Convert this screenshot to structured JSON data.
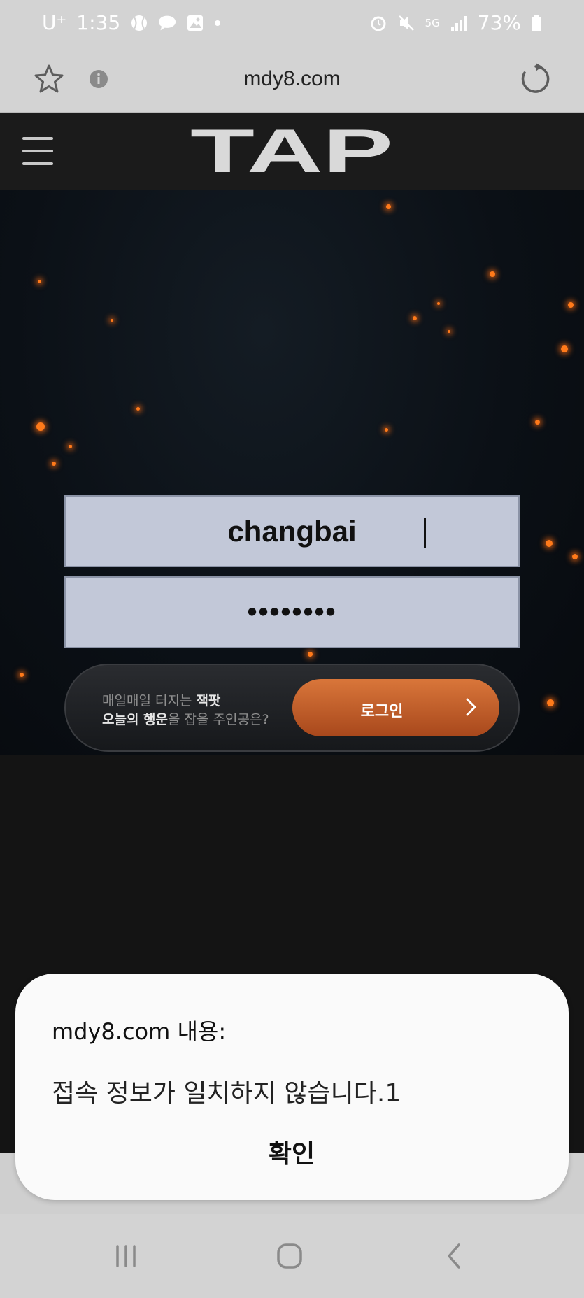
{
  "status_bar": {
    "carrier": "U⁺",
    "time": "1:35",
    "battery": "73%",
    "network": "5G"
  },
  "browser": {
    "url": "mdy8.com"
  },
  "site": {
    "logo_text": "TAP"
  },
  "login_form": {
    "username_value": "changbai",
    "password_value": "••••••••",
    "promo_line1_normal": "매일매일 터지는 ",
    "promo_line1_bold": "잭팟",
    "promo_line2_bold": "오늘의 행운",
    "promo_line2_normal": "을 잡을 주인공은?",
    "login_label": "로그인"
  },
  "dialog": {
    "title": "mdy8.com 내용:",
    "message": "접속 정보가 일치하지 않습니다.1",
    "ok_label": "확인"
  },
  "colors": {
    "accent": "#c65f28",
    "input_bg": "#c2c8d8",
    "header_bg": "#1b1b1b"
  }
}
